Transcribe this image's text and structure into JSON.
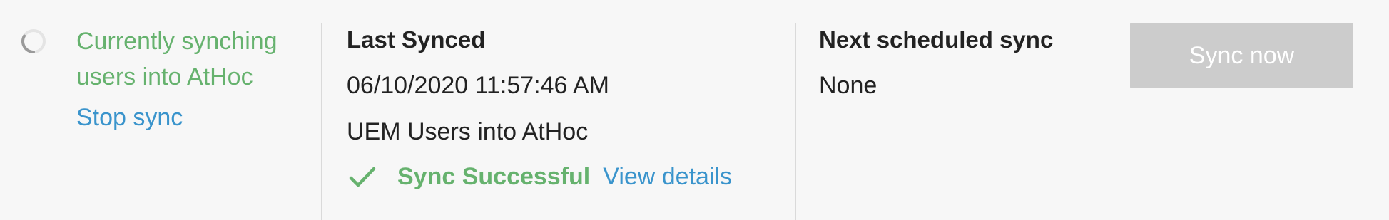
{
  "status": {
    "message": "Currently synching users into AtHoc",
    "stop_label": "Stop sync",
    "spinner_icon": "loading-spinner-icon",
    "message_color": "#66b26e"
  },
  "last_synced": {
    "heading": "Last Synced",
    "datetime": "06/10/2020 11:57:46 AM",
    "description": "UEM Users into AtHoc",
    "result_icon": "checkmark-icon",
    "result_text": "Sync Successful",
    "details_label": "View details",
    "success_color": "#66b26e"
  },
  "next_sync": {
    "heading": "Next scheduled sync",
    "value": "None"
  },
  "actions": {
    "sync_now_label": "Sync now",
    "sync_now_disabled": true
  },
  "colors": {
    "link": "#3a94cc",
    "background": "#f7f7f7",
    "disabled_button": "#cccccc"
  }
}
